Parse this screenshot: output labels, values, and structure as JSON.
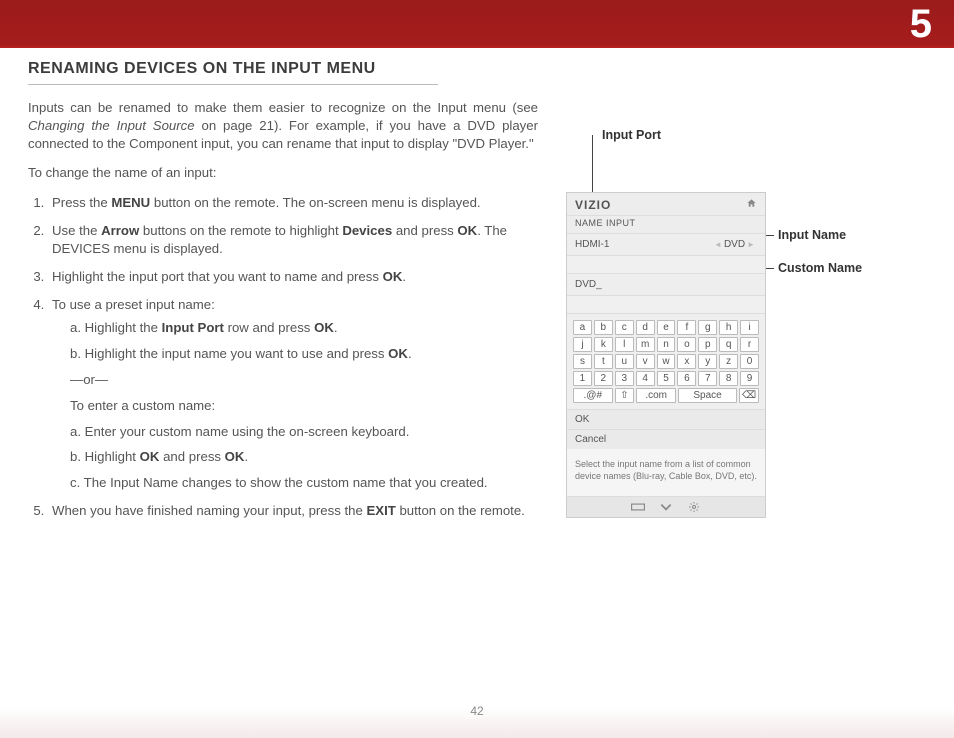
{
  "chapter_number": "5",
  "page_number": "42",
  "title": "RENAMING DEVICES ON THE INPUT MENU",
  "intro": "Inputs can be renamed to make them easier to recognize on the Input menu (see ",
  "intro_ref": "Changing the Input Source",
  "intro_tail": " on page 21). For example, if you have a DVD player connected to the Component input, you can rename that input to display \"DVD Player.\"",
  "lead": "To change the name of an input:",
  "steps": {
    "s1a": "Press the ",
    "s1b": "MENU",
    "s1c": " button on the remote. The on-screen menu is displayed.",
    "s2a": "Use the ",
    "s2b": "Arrow",
    "s2c": " buttons on the remote to highlight ",
    "s2d": "Devices",
    "s2e": " and press ",
    "s2f": "OK",
    "s2g": ". The DEVICES menu is displayed.",
    "s3a": "Highlight the input port that you want to name and press ",
    "s3b": "OK",
    "s3c": ".",
    "s4": "To use a preset input name:",
    "s4a1": "a.  Highlight the ",
    "s4a2": "Input Port",
    "s4a3": " row and press ",
    "s4a4": "OK",
    "s4a5": ".",
    "s4b1": "b.  Highlight the input name you want to use and press ",
    "s4b2": "OK",
    "s4b3": ".",
    "or": "—or—",
    "custom_lead": "To enter a custom name:",
    "c_a": "a.  Enter your custom name using the on-screen keyboard.",
    "c_b1": "b.  Highlight ",
    "c_b2": "OK",
    "c_b3": " and press ",
    "c_b4": "OK",
    "c_b5": ".",
    "c_c": "c.  The Input Name changes to show the custom name that you created.",
    "s5a": "When you have finished naming your input, press the ",
    "s5b": "EXIT",
    "s5c": " button on the remote."
  },
  "labels": {
    "port": "Input Port",
    "name": "Input Name",
    "custom": "Custom Name"
  },
  "osd": {
    "brand": "VIZIO",
    "screen_title": "NAME INPUT",
    "port_label": "HDMI-1",
    "selected_name": "DVD",
    "custom_value": "DVD_",
    "ok": "OK",
    "cancel": "Cancel",
    "help": "Select the input name from a list of common device names (Blu-ray, Cable Box, DVD, etc).",
    "keys_r1": [
      "a",
      "b",
      "c",
      "d",
      "e",
      "f",
      "g",
      "h",
      "i"
    ],
    "keys_r2": [
      "j",
      "k",
      "l",
      "m",
      "n",
      "o",
      "p",
      "q",
      "r"
    ],
    "keys_r3": [
      "s",
      "t",
      "u",
      "v",
      "w",
      "x",
      "y",
      "z",
      "0"
    ],
    "keys_r4": [
      "1",
      "2",
      "3",
      "4",
      "5",
      "6",
      "7",
      "8",
      "9"
    ],
    "sym": ".@#",
    "shift": "⇧",
    "com": ".com",
    "space": "Space",
    "del": "⌫"
  }
}
